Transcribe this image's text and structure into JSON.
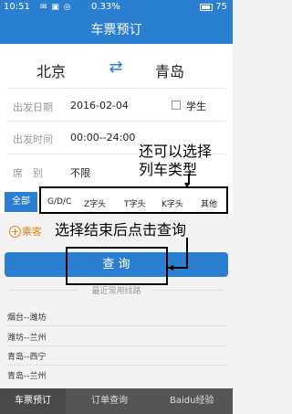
{
  "status_bar": {
    "time": "10:51",
    "battery_percent": "0.33%",
    "battery_level": "75"
  },
  "title": "车票预订",
  "from_city": "北京",
  "to_city": "青岛",
  "departure_date": {
    "label": "出发日期",
    "value": "2016-02-04"
  },
  "student_label": "学生",
  "departure_time": {
    "label": "出发时间",
    "value": "00:00--24:00"
  },
  "seat_class": {
    "label": "席　别",
    "value": "不限"
  },
  "filters": [
    "全部",
    "G/D/C",
    "Z字头",
    "T字头",
    "K字头",
    "其他"
  ],
  "passenger_label": "乘客",
  "query_button": "查 询",
  "recent_routes_title": "最近常用线路",
  "recent_routes": [
    "烟台--潍坊",
    "潍坊--兰州",
    "青岛--西宁",
    "青岛--兰州"
  ],
  "tabs": [
    "车票预订",
    "订单查询",
    "Baidu经验"
  ],
  "annotations": {
    "note1": "还可以选择",
    "note2": "列车类型",
    "note3": "选择结束后点击查询"
  }
}
